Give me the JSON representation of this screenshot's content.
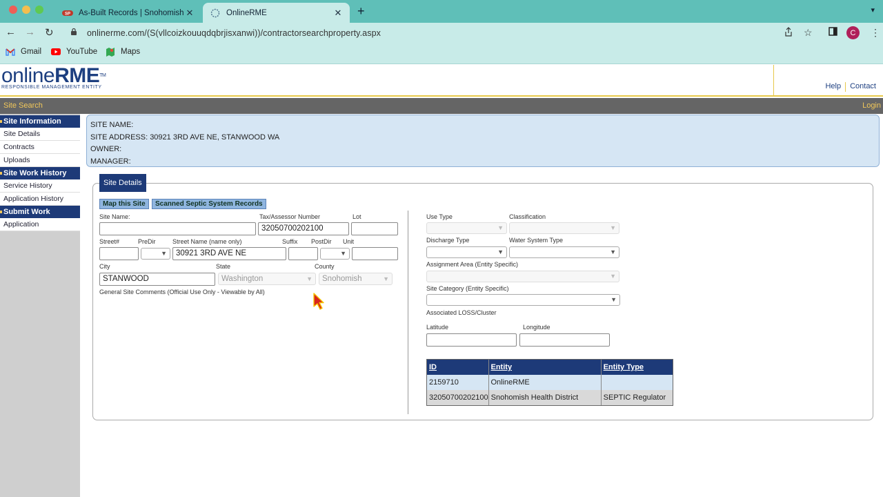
{
  "browser": {
    "tabs": [
      {
        "title": "As-Built Records | Snohomish C",
        "active": false
      },
      {
        "title": "OnlineRME",
        "active": true
      }
    ],
    "url": "onlinerme.com/(S(vllcoizkouuqdqbrjisxanwi))/contractorsearchproperty.aspx",
    "avatar_letter": "C",
    "bookmarks": [
      {
        "label": "Gmail",
        "icon": "gmail-icon"
      },
      {
        "label": "YouTube",
        "icon": "youtube-icon"
      },
      {
        "label": "Maps",
        "icon": "maps-icon"
      }
    ]
  },
  "header": {
    "logo_online": "online",
    "logo_rme": "RME",
    "logo_tm": "TM",
    "logo_sub": "RESPONSIBLE MANAGEMENT ENTITY",
    "links": [
      "Help",
      "Contact"
    ]
  },
  "navbar": {
    "left": "Site Search",
    "right": "Login"
  },
  "sidebar": {
    "sections": [
      {
        "title": "Site Information",
        "items": [
          "Site Details",
          "Contracts",
          "Uploads"
        ]
      },
      {
        "title": "Site Work History",
        "items": [
          "Service History",
          "Application History"
        ]
      },
      {
        "title": "Submit Work",
        "items": [
          "Application"
        ]
      }
    ]
  },
  "info": {
    "site_name": "SITE NAME:",
    "site_address": "SITE ADDRESS: 30921 3RD AVE NE, STANWOOD WA",
    "owner": "OWNER:",
    "manager": "MANAGER:"
  },
  "details": {
    "tab": "Site Details",
    "buttons": {
      "map": "Map this Site",
      "scanned": "Scanned Septic System Records"
    },
    "labels": {
      "site_name": "Site Name:",
      "tax": "Tax/Assessor Number",
      "lot": "Lot",
      "street_no": "Street#",
      "predir": "PreDir",
      "street_name": "Street Name (name only)",
      "suffix": "Suffix",
      "postdir": "PostDir",
      "unit": "Unit",
      "city": "City",
      "state": "State",
      "county": "County",
      "comments": "General Site Comments (Official Use Only - Viewable by All)",
      "use_type": "Use Type",
      "classification": "Classification",
      "discharge": "Discharge Type",
      "water": "Water System Type",
      "assignment": "Assignment Area (Entity Specific)",
      "site_category": "Site Category (Entity Specific)",
      "loss": "Associated LOSS/Cluster",
      "latitude": "Latitude",
      "longitude": "Longitude"
    },
    "values": {
      "site_name": "",
      "tax": "32050700202100",
      "lot": "",
      "street_no": "",
      "street_name": "30921 3RD AVE NE",
      "suffix": "",
      "unit": "",
      "city": "STANWOOD",
      "state": "Washington",
      "county": "Snohomish",
      "latitude": "",
      "longitude": ""
    }
  },
  "entity_table": {
    "headers": [
      "ID",
      "Entity",
      "Entity Type"
    ],
    "rows": [
      [
        "2159710",
        "OnlineRME",
        ""
      ],
      [
        "32050700202100",
        "Snohomish Health District",
        "SEPTIC Regulator"
      ]
    ]
  }
}
